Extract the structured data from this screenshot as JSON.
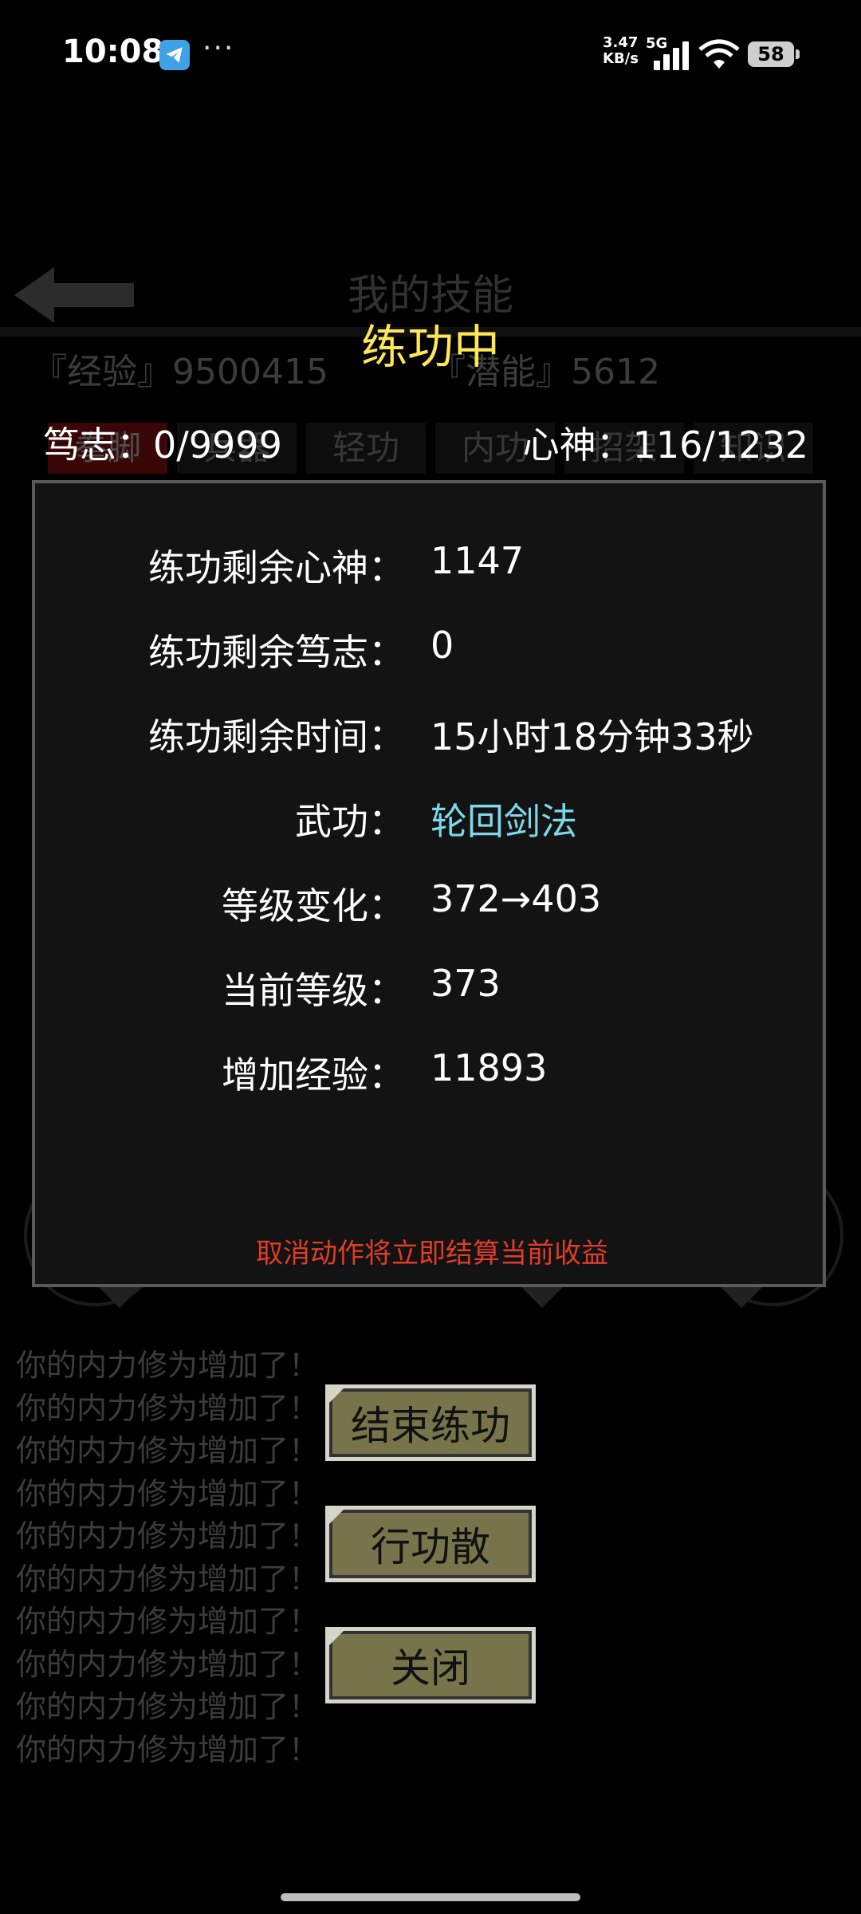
{
  "status_bar": {
    "time": "10:08",
    "more": "···",
    "net_speed_value": "3.47",
    "net_speed_unit": "KB/s",
    "net_type": "5G",
    "battery": "58"
  },
  "background": {
    "title": "我的技能",
    "exp": "『经验』9500415",
    "potential": "『潜能』5612",
    "tabs": [
      "拳脚",
      "兵器",
      "轻功",
      "内功",
      "招架",
      "知识"
    ]
  },
  "dialog": {
    "title": "练功中",
    "will_label": "笃志：0/9999",
    "mind_label": "心神：116/1232",
    "rows": [
      {
        "label": "练功剩余心神：",
        "value": "1147"
      },
      {
        "label": "练功剩余笃志：",
        "value": "0"
      },
      {
        "label": "练功剩余时间：",
        "value": "15小时18分钟33秒"
      },
      {
        "label": "武功：",
        "value": "轮回剑法"
      },
      {
        "label": "等级变化：",
        "value": "372→403"
      },
      {
        "label": "当前等级：",
        "value": "373"
      },
      {
        "label": "增加经验：",
        "value": "11893"
      }
    ],
    "warning": "取消动作将立即结算当前收益"
  },
  "log_lines": [
    "你的内力修为增加了！",
    "你的内力修为增加了！",
    "你的内力修为增加了！",
    "你的内力修为增加了！",
    "你的内力修为增加了！",
    "你的内力修为增加了！",
    "你的内力修为增加了！",
    "你的内力修为增加了！",
    "你的内力修为增加了！",
    "你的内力修为增加了！"
  ],
  "buttons": {
    "end_training": "结束练功",
    "xinggongsan": "行功散",
    "close": "关闭"
  },
  "colors": {
    "title": "#ffe657",
    "skill": "#7fd8ea",
    "warning": "#e03c2a",
    "button_bg": "#77744c"
  }
}
